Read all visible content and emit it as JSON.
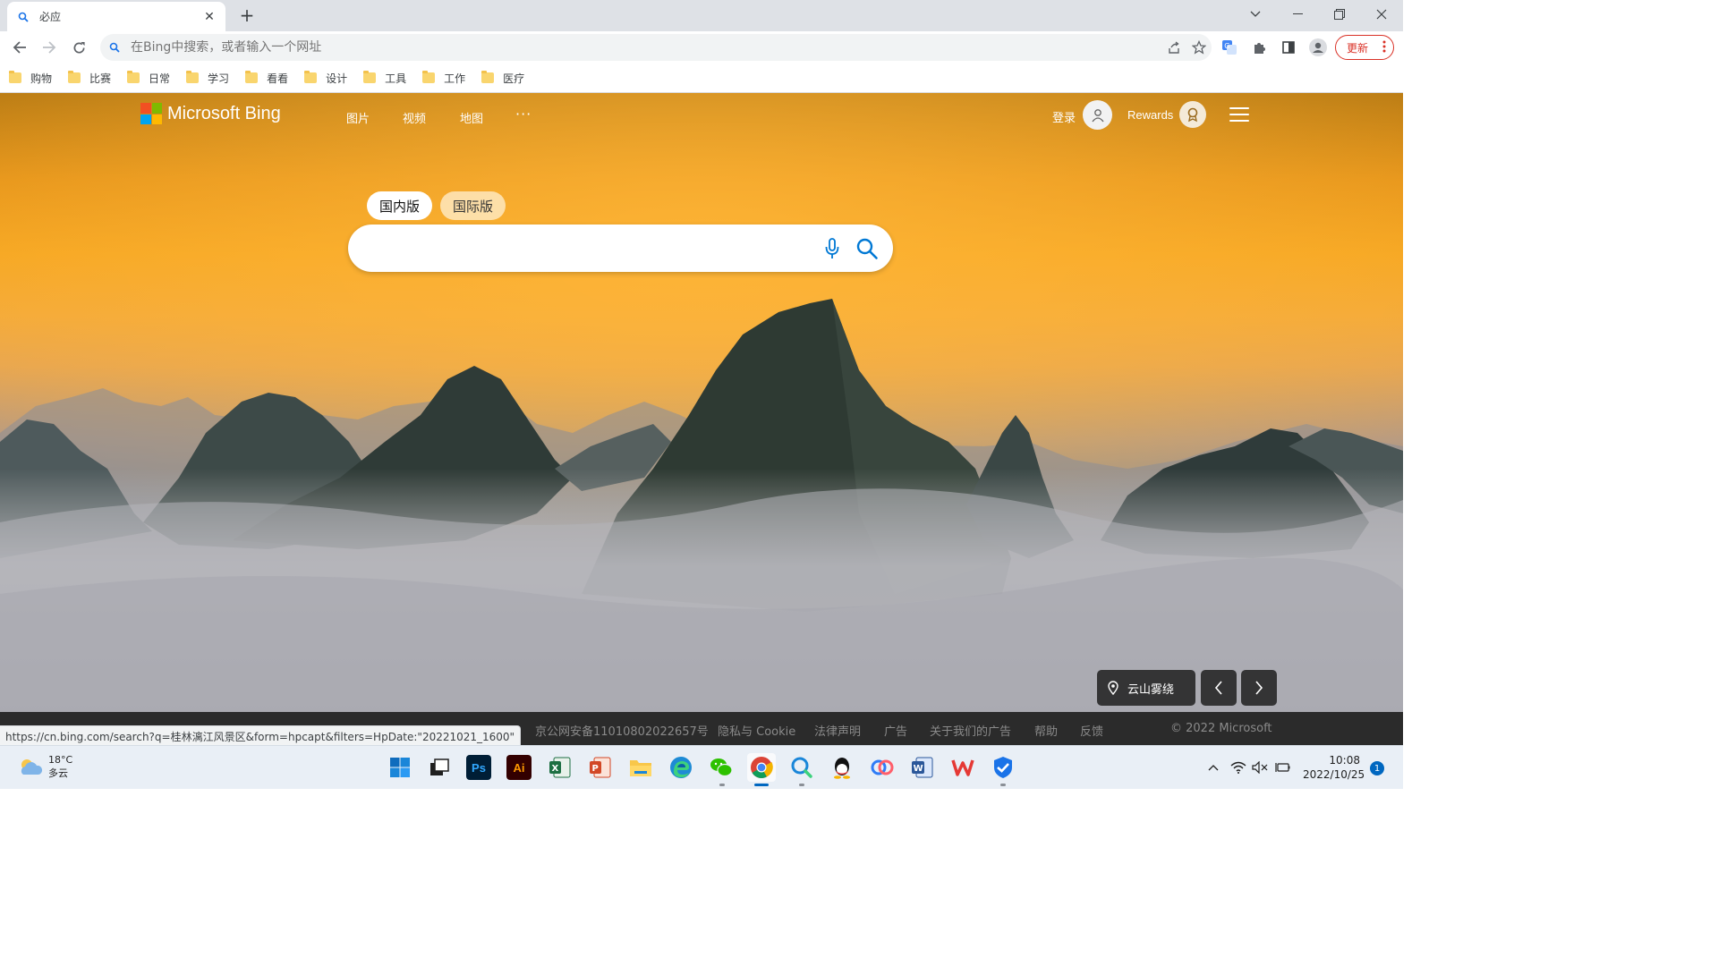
{
  "browser": {
    "tab": {
      "title": "必应",
      "close": "✕"
    },
    "new_tab": "+",
    "omnibox": {
      "placeholder": "在Bing中搜索，或者输入一个网址",
      "value": ""
    },
    "update_label": "更新",
    "bookmarks": [
      "购物",
      "比赛",
      "日常",
      "学习",
      "看看",
      "设计",
      "工具",
      "工作",
      "医疗"
    ],
    "status_url": "https://cn.bing.com/search?q=桂林漓江风景区&form=hpcapt&filters=HpDate:\"20221021_1600\""
  },
  "bing": {
    "logo_text": "Microsoft Bing",
    "nav": {
      "images": "图片",
      "videos": "视频",
      "maps": "地图",
      "more": "···"
    },
    "signin": "登录",
    "rewards": "Rewards",
    "scope_tabs": {
      "domestic": "国内版",
      "international": "国际版"
    },
    "search_placeholder": "",
    "location_label": "云山雾绕",
    "footer": {
      "links": [
        "京公网安备11010802022657号",
        "隐私与 Cookie",
        "法律声明",
        "广告",
        "关于我们的广告",
        "帮助",
        "反馈"
      ],
      "copyright": "© 2022 Microsoft"
    },
    "colors": {
      "accent": "#0078d4",
      "footer_bg": "#2b2b2b"
    }
  },
  "taskbar": {
    "weather": {
      "temp": "18°C",
      "condition": "多云"
    },
    "clock": {
      "time": "10:08",
      "date": "2022/10/25"
    },
    "notifications": "1",
    "apps": [
      "start-icon",
      "task-view-icon",
      "photoshop-icon",
      "illustrator-icon",
      "excel-icon",
      "powerpoint-icon",
      "file-explorer-icon",
      "edge-icon",
      "wechat-icon",
      "chrome-icon",
      "search-app-icon",
      "qq-icon",
      "baidu-netdisk-icon",
      "word-icon",
      "wps-icon",
      "security-icon"
    ]
  }
}
